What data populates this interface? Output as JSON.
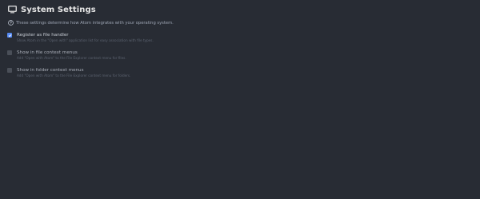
{
  "header": {
    "title": "System Settings",
    "icon": "monitor-icon"
  },
  "intro": {
    "icon": "question-circle-icon",
    "text": "These settings determine how Atom integrates with your operating system."
  },
  "settings": [
    {
      "label": "Register as file handler",
      "description": "Show Atom in the \"Open with\" application list for easy association with file types.",
      "checked": true
    },
    {
      "label": "Show in file context menus",
      "description": "Add \"Open with Atom\" to the File Explorer context menu for files.",
      "checked": false
    },
    {
      "label": "Show in folder context menus",
      "description": "Add \"Open with Atom\" to the File Explorer context menu for folders.",
      "checked": false
    }
  ],
  "colors": {
    "background": "#282c34",
    "accent": "#568af2",
    "unchecked": "#4a4f58"
  }
}
